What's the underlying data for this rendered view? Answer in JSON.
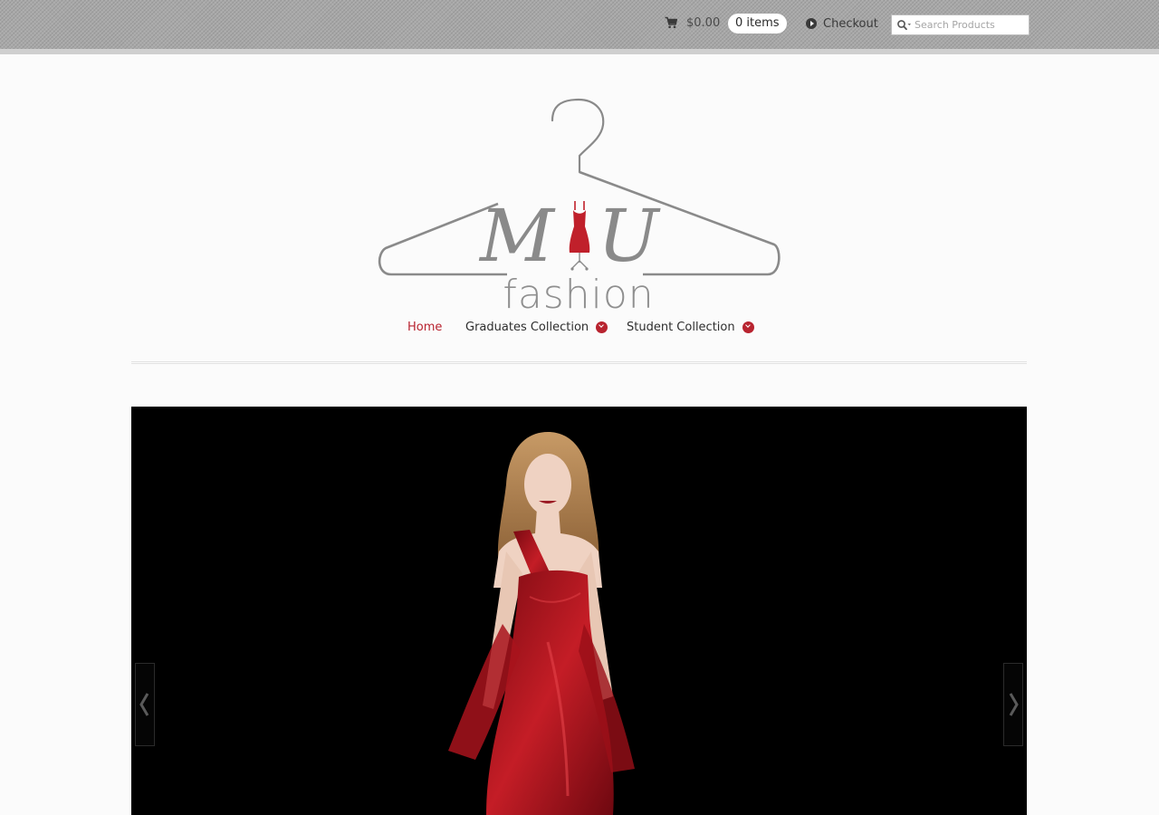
{
  "header": {
    "cart_total": "$0.00",
    "cart_items": "0 items",
    "checkout_label": "Checkout",
    "search_placeholder": "Search Products"
  },
  "logo": {
    "script_letters": "M U",
    "brand_word": "fashion"
  },
  "nav": {
    "items": [
      {
        "label": "Home",
        "active": true
      },
      {
        "label": "Graduates Collection",
        "has_dropdown": true
      },
      {
        "label": "Student Collection",
        "has_dropdown": true
      }
    ]
  },
  "slider": {
    "prev_icon": "chevron-left-icon",
    "next_icon": "chevron-right-icon"
  },
  "colors": {
    "accent": "#b8232f",
    "topbar": "#a8a8a8",
    "slider_bg": "#000000",
    "text": "#2e2e2e"
  }
}
